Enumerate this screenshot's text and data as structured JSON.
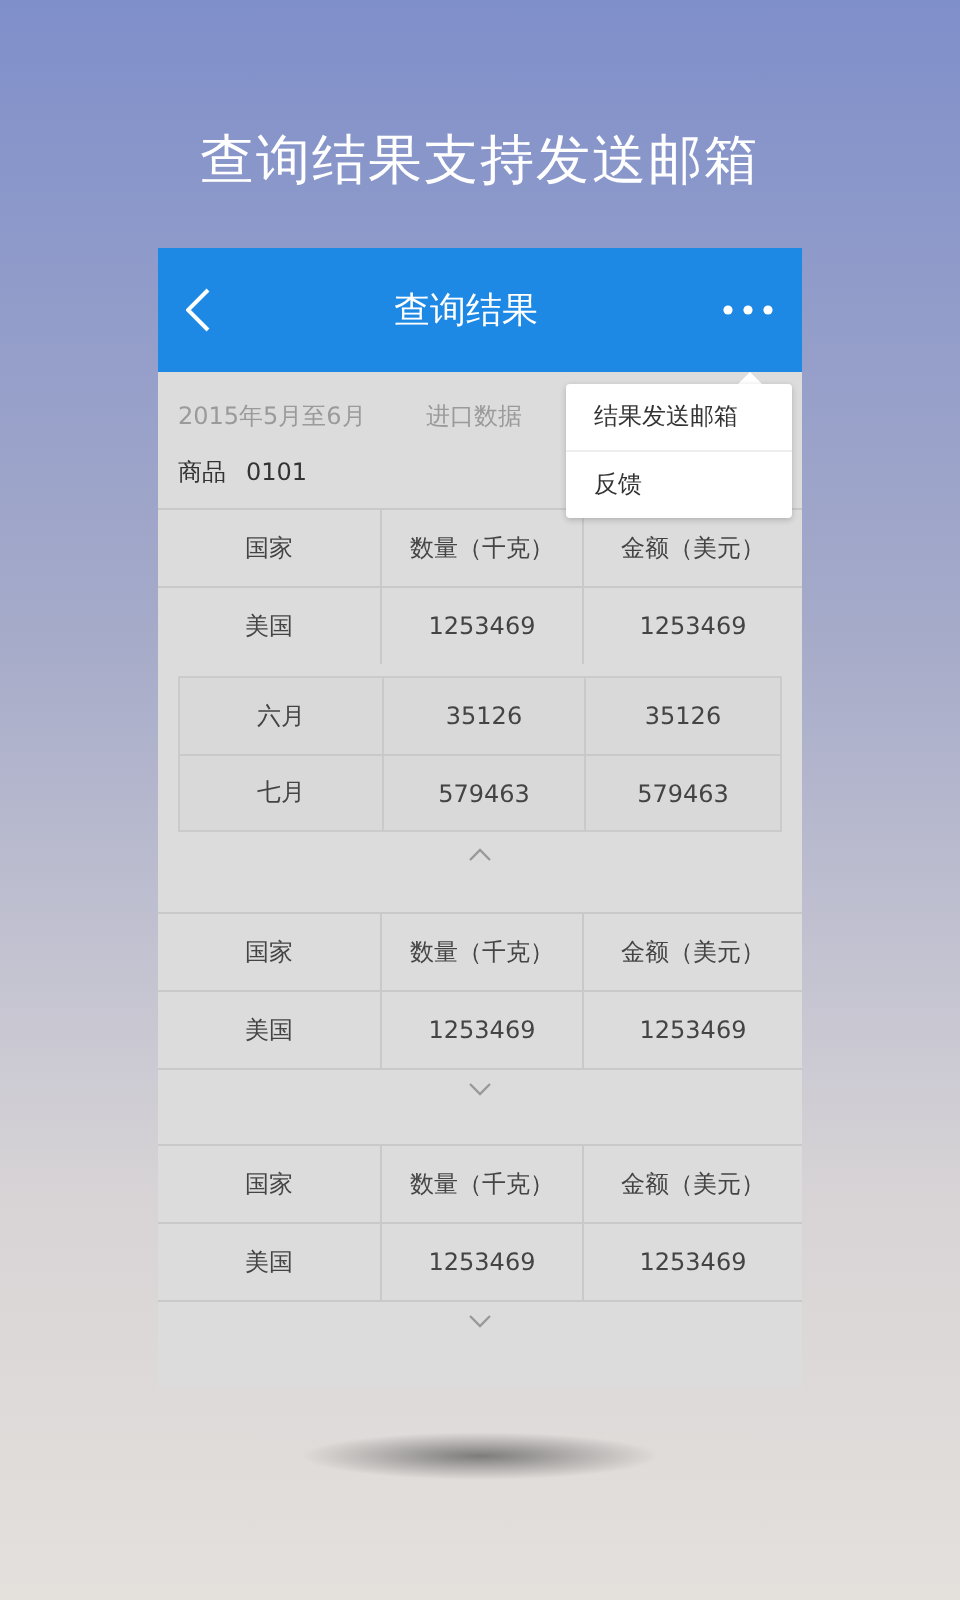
{
  "headline": "查询结果支持发送邮箱",
  "header": {
    "title": "查询结果"
  },
  "info": {
    "period": "2015年5月至6月",
    "type": "进口数据",
    "product_label": "商品",
    "product_code": "0101"
  },
  "tables": [
    {
      "columns": [
        "国家",
        "数量（千克）",
        "金额（美元）"
      ],
      "rows": [
        [
          "美国",
          "1253469",
          "1253469"
        ]
      ],
      "expanded": true,
      "details": [
        [
          "六月",
          "35126",
          "35126"
        ],
        [
          "七月",
          "579463",
          "579463"
        ]
      ]
    },
    {
      "columns": [
        "国家",
        "数量（千克）",
        "金额（美元）"
      ],
      "rows": [
        [
          "美国",
          "1253469",
          "1253469"
        ]
      ],
      "expanded": false
    },
    {
      "columns": [
        "国家",
        "数量（千克）",
        "金额（美元）"
      ],
      "rows": [
        [
          "美国",
          "1253469",
          "1253469"
        ]
      ],
      "expanded": false
    }
  ],
  "menu": {
    "items": [
      "结果发送邮箱",
      "反馈"
    ]
  }
}
